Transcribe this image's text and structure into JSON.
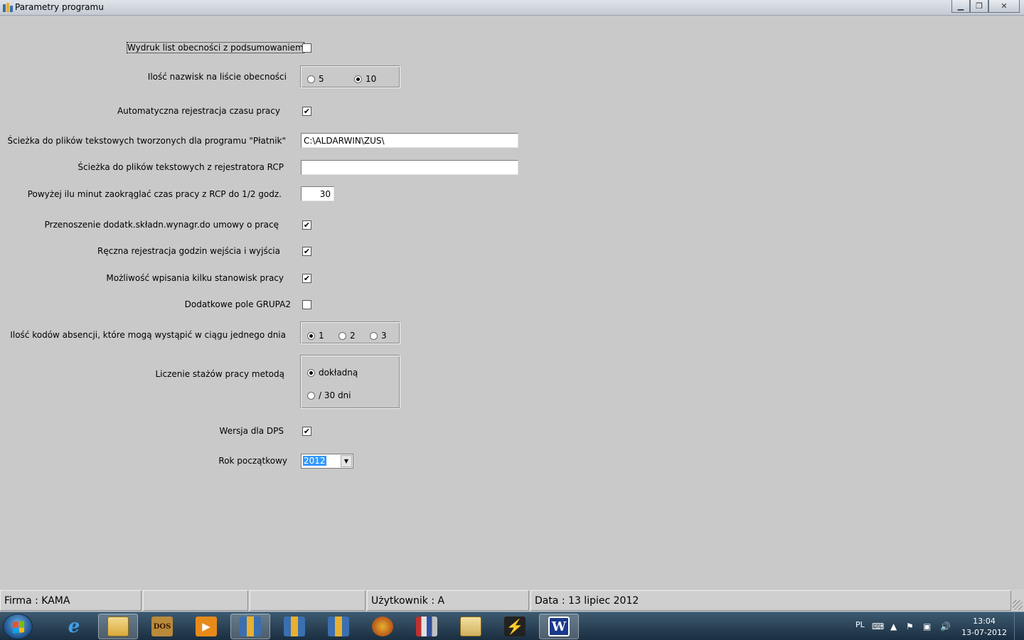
{
  "window": {
    "title": "Parametry programu"
  },
  "form": {
    "attendance_print_label": "Wydruk list obecności z podsumowaniem",
    "attendance_print_checked": false,
    "names_count_label": "Ilość nazwisk na liście obecności",
    "names_count_options": [
      "5",
      "10"
    ],
    "names_count_selected": "10",
    "auto_registration_label": "Automatyczna rejestracja czasu pracy",
    "auto_registration_checked": true,
    "platnik_path_label": "Ścieżka do plików tekstowych tworzonych dla programu \"Płatnik\"",
    "platnik_path_value": "C:\\ALDARWIN\\ZUS\\",
    "rcp_path_label": "Ścieżka do plików tekstowych z rejestratora RCP",
    "rcp_path_value": "",
    "rounding_label": "Powyżej ilu minut zaokrąglać czas pracy z RCP do 1/2 godz.",
    "rounding_value": "30",
    "transfer_label": "Przenoszenie dodatk.składn.wynagr.do umowy o pracę",
    "transfer_checked": true,
    "manual_registration_label": "Ręczna rejestracja godzin wejścia i wyjścia",
    "manual_registration_checked": true,
    "multi_position_label": "Możliwość wpisania kilku stanowisk pracy",
    "multi_position_checked": true,
    "group2_label": "Dodatkowe pole GRUPA2",
    "group2_checked": false,
    "absence_codes_label": "Ilość kodów absencji, które mogą wystąpić w ciągu jednego dnia",
    "absence_codes_options": [
      "1",
      "2",
      "3"
    ],
    "absence_codes_selected": "1",
    "seniority_label": "Liczenie stażów pracy metodą",
    "seniority_options": [
      "dokładną",
      "/ 30 dni"
    ],
    "seniority_selected": "dokładną",
    "dps_label": "Wersja dla DPS",
    "dps_checked": true,
    "start_year_label": "Rok początkowy",
    "start_year_value": "2012"
  },
  "statusbar": {
    "company": "Firma : KAMA",
    "panel2": "",
    "panel3": "",
    "user": "Użytkownik : A",
    "date": "Data : 13 lipiec 2012"
  },
  "taskbar": {
    "language": "PL",
    "time": "13:04",
    "date": "13-07-2012",
    "apps": [
      "internet-explorer",
      "file-explorer",
      "dosbox",
      "media-player",
      "program-1",
      "program-2",
      "program-3",
      "helmet-app",
      "archive-app",
      "folder-app",
      "winamp-app",
      "word"
    ]
  },
  "colors": {
    "background": "#c9c9c9",
    "selection": "#3399ff",
    "taskbar": "#1a2e40"
  }
}
